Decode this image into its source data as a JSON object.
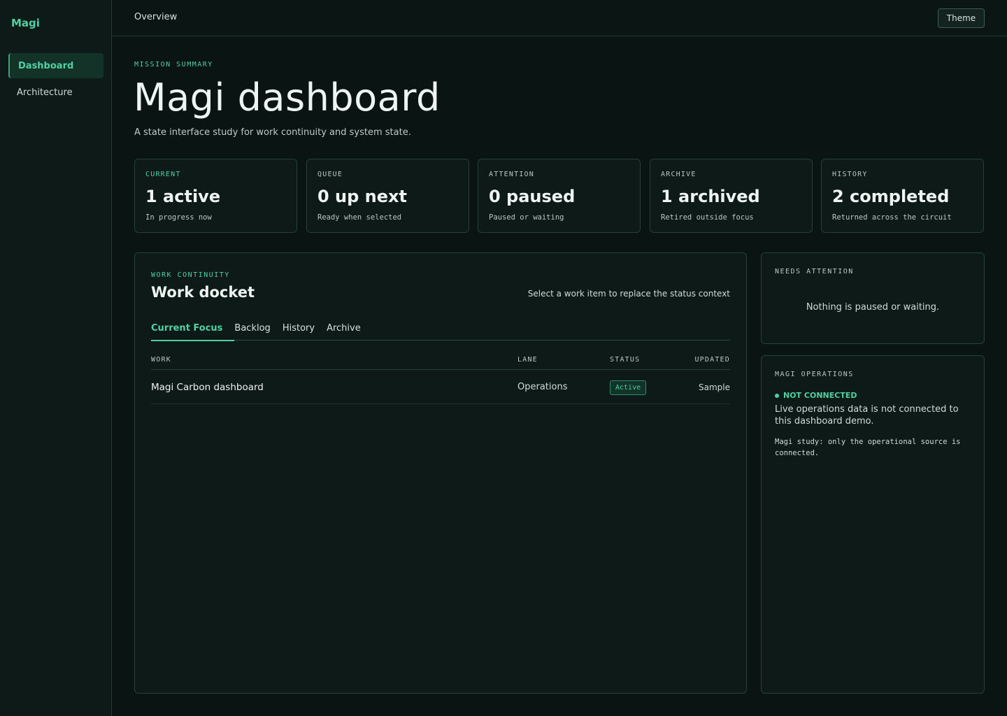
{
  "sidebar": {
    "brand": "Magi",
    "items": [
      {
        "label": "Dashboard",
        "active": true
      },
      {
        "label": "Architecture",
        "active": false
      }
    ]
  },
  "topbar": {
    "title": "Overview",
    "theme_label": "Theme"
  },
  "header": {
    "eyebrow": "MISSION SUMMARY",
    "title": "Magi dashboard",
    "subtitle": "A state interface study for work continuity and system state."
  },
  "stats": [
    {
      "label": "CURRENT",
      "value": "1 active",
      "note": "In progress now"
    },
    {
      "label": "QUEUE",
      "value": "0 up next",
      "note": "Ready when selected"
    },
    {
      "label": "ATTENTION",
      "value": "0 paused",
      "note": "Paused or waiting"
    },
    {
      "label": "ARCHIVE",
      "value": "1 archived",
      "note": "Retired outside focus"
    },
    {
      "label": "HISTORY",
      "value": "2 completed",
      "note": "Returned across the circuit"
    }
  ],
  "docket": {
    "eyebrow": "WORK CONTINUITY",
    "title": "Work docket",
    "hint": "Select a work item to replace the status context",
    "tabs": [
      {
        "label": "Current Focus",
        "active": true
      },
      {
        "label": "Backlog",
        "active": false
      },
      {
        "label": "History",
        "active": false
      },
      {
        "label": "Archive",
        "active": false
      }
    ],
    "columns": [
      "WORK",
      "LANE",
      "STATUS",
      "UPDATED"
    ],
    "rows": [
      {
        "work": "Magi Carbon dashboard",
        "lane": "Operations",
        "status": "Active",
        "updated": "Sample"
      }
    ]
  },
  "needs_attention": {
    "eyebrow": "NEEDS ATTENTION",
    "message": "Nothing is paused or waiting."
  },
  "operations": {
    "eyebrow": "MAGI OPERATIONS",
    "status": "NOT CONNECTED",
    "description": "Live operations data is not connected to this dashboard demo.",
    "note": "Magi study: only the operational source is connected."
  },
  "colors": {
    "accent": "#4fd1a0",
    "background": "#0a1412",
    "panel": "#0e1a17",
    "border": "#25413a"
  }
}
